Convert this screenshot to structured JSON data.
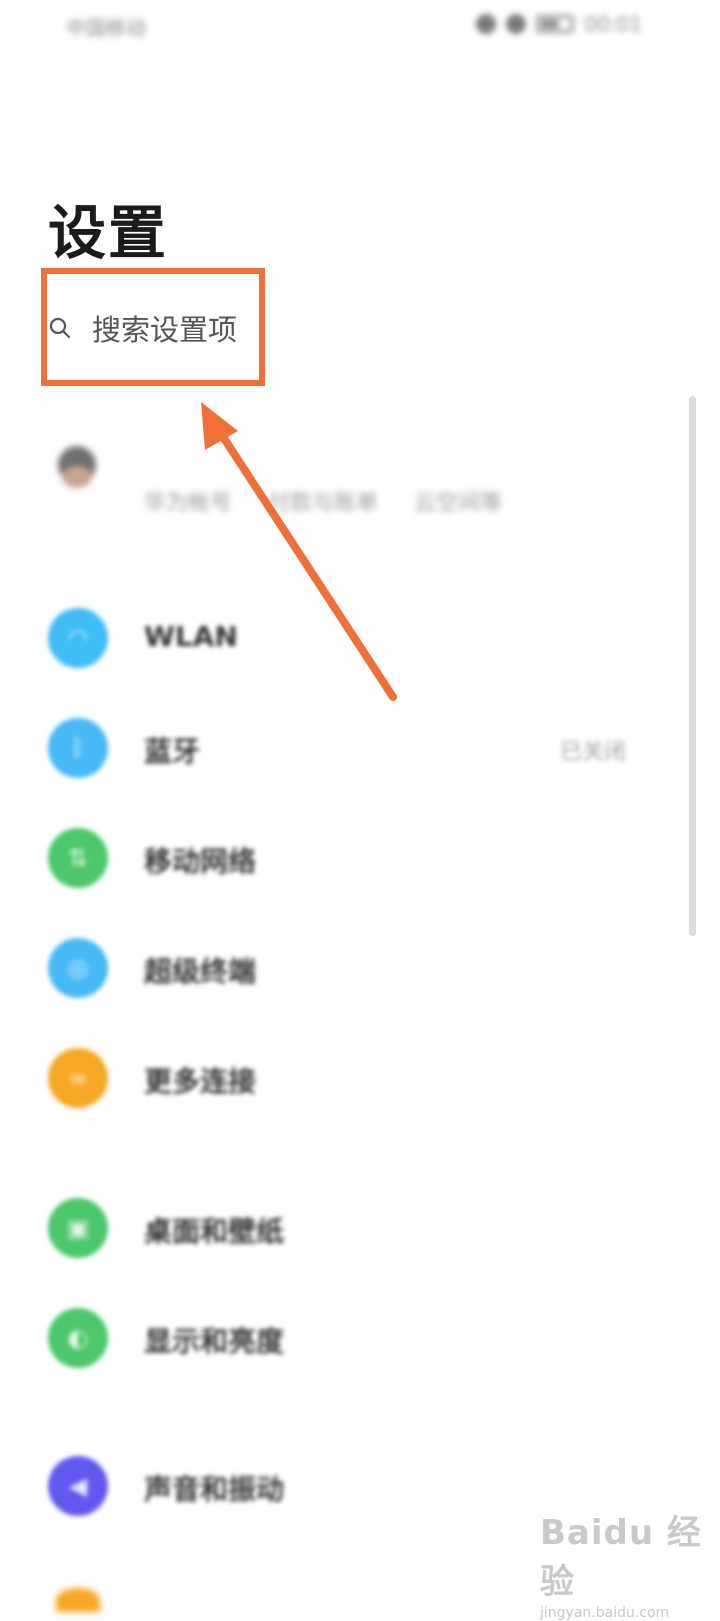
{
  "status_bar": {
    "carrier": "中国移动",
    "time": "00:01"
  },
  "page": {
    "title": "设置"
  },
  "search": {
    "label": "搜索设置项"
  },
  "account": {
    "links": [
      "华为帐号",
      "付款与账单",
      "云空间等"
    ]
  },
  "settings": [
    {
      "label": "WLAN",
      "value": "",
      "color": "#3fbdf7",
      "icon": "wifi-icon"
    },
    {
      "label": "蓝牙",
      "value": "已关闭",
      "color": "#46b9f6",
      "icon": "bluetooth-icon"
    },
    {
      "label": "移动网络",
      "value": "",
      "color": "#4cc76a",
      "icon": "mobile-network-icon"
    },
    {
      "label": "超级终端",
      "value": "",
      "color": "#46b9f6",
      "icon": "super-device-icon"
    },
    {
      "label": "更多连接",
      "value": "",
      "color": "#f6a723",
      "icon": "more-connections-icon"
    },
    {
      "label": "桌面和壁纸",
      "value": "",
      "color": "#4cc76a",
      "icon": "wallpaper-icon"
    },
    {
      "label": "显示和亮度",
      "value": "",
      "color": "#4cc76a",
      "icon": "display-icon"
    },
    {
      "label": "声音和振动",
      "value": "",
      "color": "#6257ee",
      "icon": "sound-icon"
    }
  ],
  "watermark": {
    "main": "Baidu 经验",
    "sub": "jingyan.baidu.com"
  },
  "accent_colors": {
    "highlight": "#f0703a"
  }
}
